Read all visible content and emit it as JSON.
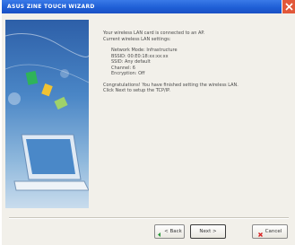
{
  "title": "ASUS ZINE TOUCH WIZARD",
  "body": {
    "intro_lines": [
      "Your wireless LAN card is connected to an AP.",
      "Current wireless LAN settings:"
    ],
    "settings": [
      "Network Mode: Infrastructure",
      "BSSID: 00:E0:18:xx:xx:xx",
      "SSID: Any default",
      "Channel: 6",
      "Encryption: Off"
    ],
    "closing_lines": [
      "Congratulations! You have finished setting the wireless LAN.",
      "Click Next to setup the TCP/IP."
    ]
  },
  "buttons": {
    "back": "< Back",
    "next": "Next >",
    "cancel": "Cancel"
  },
  "colors": {
    "titlebar": "#1f5fd6",
    "cancel_icon": "#d81e1e"
  }
}
